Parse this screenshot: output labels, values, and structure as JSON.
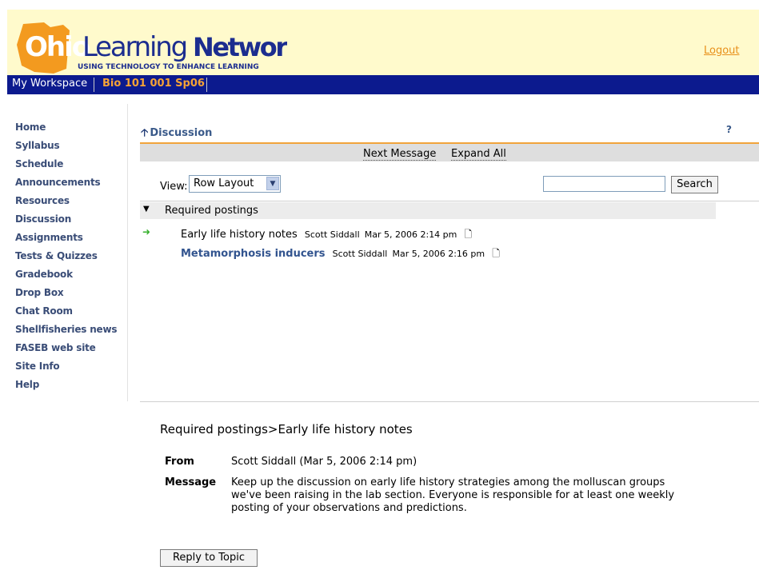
{
  "header": {
    "logo": {
      "text_ohio": "Ohio",
      "text_learning": "Learning",
      "text_network": "Network",
      "tagline": "USING TECHNOLOGY TO ENHANCE LEARNING"
    },
    "logout_label": "Logout"
  },
  "site_tabs": [
    {
      "label": "My Workspace"
    },
    {
      "label": "Bio 101 001 Sp06"
    }
  ],
  "nav": {
    "items": [
      {
        "label": "Home"
      },
      {
        "label": "Syllabus"
      },
      {
        "label": "Schedule"
      },
      {
        "label": "Announcements"
      },
      {
        "label": "Resources"
      },
      {
        "label": "Discussion"
      },
      {
        "label": "Assignments"
      },
      {
        "label": "Tests & Quizzes"
      },
      {
        "label": "Gradebook"
      },
      {
        "label": "Drop Box"
      },
      {
        "label": "Chat Room"
      },
      {
        "label": "Shellfisheries news"
      },
      {
        "label": "FASEB web site"
      },
      {
        "label": "Site Info"
      },
      {
        "label": "Help"
      }
    ]
  },
  "tool": {
    "title": "Discussion",
    "help_label": "?",
    "actions": {
      "next_message": "Next Message",
      "expand_all": "Expand All"
    },
    "view_label": "View:",
    "view_selected": "Row Layout",
    "search_value": "",
    "search_button": "Search"
  },
  "topic": {
    "label": "Required postings",
    "messages": [
      {
        "subject": "Early life history notes",
        "author": "Scott Siddall",
        "date": "Mar 5, 2006 2:14 pm",
        "current": true
      },
      {
        "subject": "Metamorphosis inducers",
        "author": "Scott Siddall",
        "date": "Mar 5, 2006 2:16 pm",
        "current": false
      }
    ]
  },
  "detail": {
    "breadcrumb": "Required postings>Early life history notes",
    "from_label": "From",
    "from_value": "Scott Siddall (Mar 5, 2006 2:14 pm)",
    "message_label": "Message",
    "message_text": "Keep up the discussion on early life history strategies among the molluscan groups we've been raising in the lab section.  Everyone is responsible for at least one weekly posting of your observations and predictions.",
    "reply_button": "Reply to Topic"
  },
  "colors": {
    "banner_bg": "#fffacc",
    "site_bar": "#0c1a8e",
    "current_site": "#f7a335",
    "nav_link": "#3a4d77",
    "accent_rule": "#f1a43c",
    "logo_ohio": "#f39a1f",
    "logo_blue": "#1c2d8f"
  }
}
